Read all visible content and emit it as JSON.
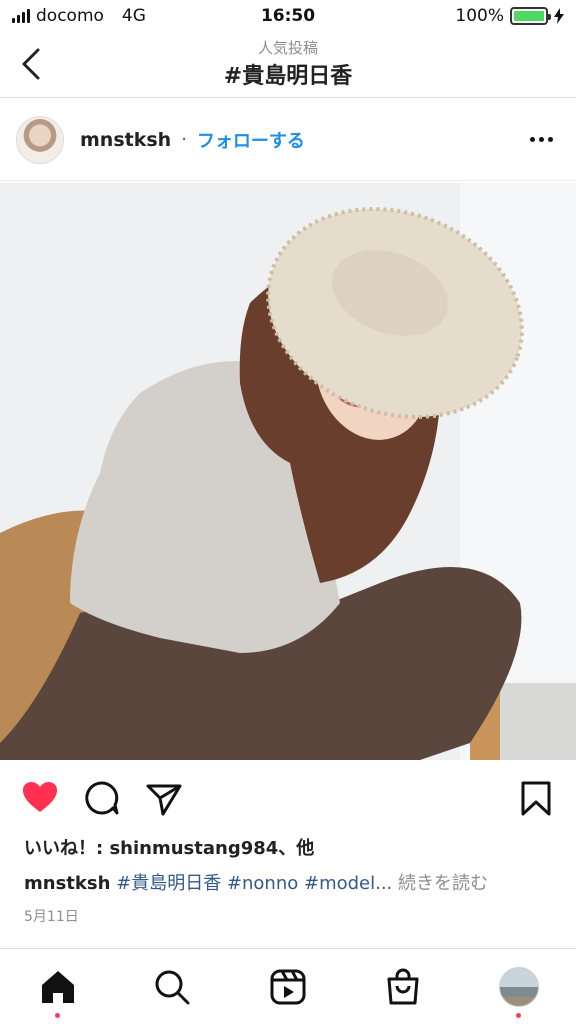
{
  "status_bar": {
    "carrier": "docomo",
    "network": "4G",
    "time": "16:50",
    "battery": "100%",
    "battery_level": 1.0
  },
  "header": {
    "subtitle": "人気投稿",
    "title": "#貴島明日香"
  },
  "post": {
    "username": "mnstksh",
    "separator": "·",
    "follow_label": "フォローする",
    "likes_text": "いいね！: shinmustang984、他",
    "caption_user": "mnstksh",
    "caption_tags": "#貴島明日香 #nonno #model...",
    "caption_more": "続きを読む",
    "date": "5月11日",
    "liked": true
  },
  "icons": {
    "back": "chevron-left-icon",
    "more": "more-horizontal-icon",
    "like": "heart-icon",
    "comment": "comment-icon",
    "share": "paper-plane-icon",
    "save": "bookmark-icon",
    "tabs": [
      "home-icon",
      "search-icon",
      "reels-icon",
      "shop-icon",
      "profile-avatar"
    ]
  },
  "colors": {
    "like": "#ff3050",
    "link": "#1f8ee8",
    "hashtag": "#33598c",
    "muted": "#8e8e8e",
    "battery": "#4cd964",
    "notification_dot": "#ff3b5c"
  }
}
